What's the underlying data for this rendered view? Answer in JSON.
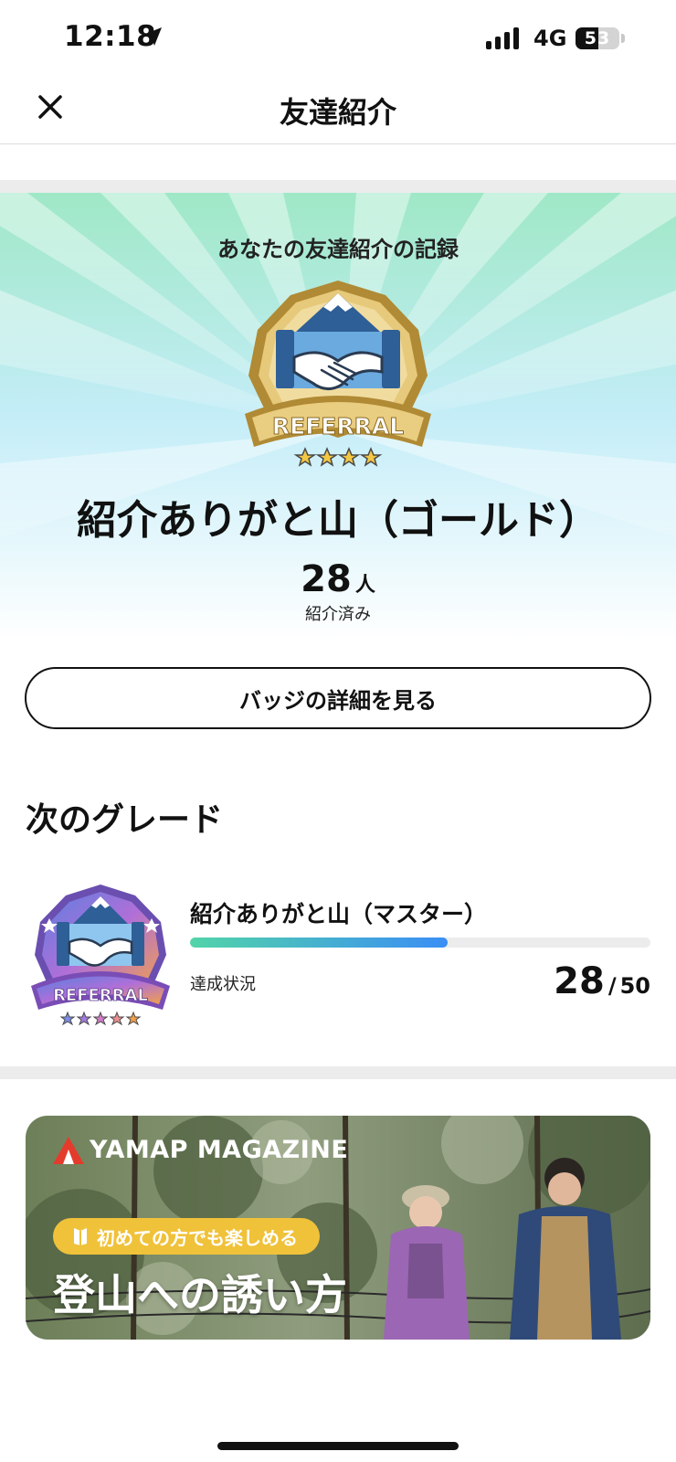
{
  "status_bar": {
    "time": "12:18",
    "network": "4G",
    "battery_level": "53"
  },
  "nav": {
    "title": "友達紹介",
    "close_icon": "close-icon"
  },
  "hero": {
    "subtitle": "あなたの友達紹介の記録",
    "badge_text": "REFERRAL",
    "badge_stars_filled": 4,
    "title": "紹介ありがと山（ゴールド）",
    "count": "28",
    "count_unit": "人",
    "count_caption": "紹介済み",
    "colors": {
      "top": "#9fe8c6",
      "middle": "#c2ecf7",
      "bottom": "#ffffff"
    }
  },
  "detail_button": {
    "label": "バッジの詳細を見る"
  },
  "next_grade": {
    "section_title": "次のグレード",
    "badge_text": "REFERRAL",
    "badge_stars": 5,
    "name": "紹介ありがと山（マスター）",
    "progress_label": "達成状況",
    "current": "28",
    "separator": "/",
    "total": "50",
    "progress_fraction": 0.56,
    "progress_colors": [
      "#52d4a8",
      "#3b8ef5"
    ]
  },
  "banner": {
    "brand": "YAMAP MAGAZINE",
    "tag": "初めての方でも楽しめる",
    "title": "登山への誘い方",
    "tag_color": "#f0c23a"
  }
}
